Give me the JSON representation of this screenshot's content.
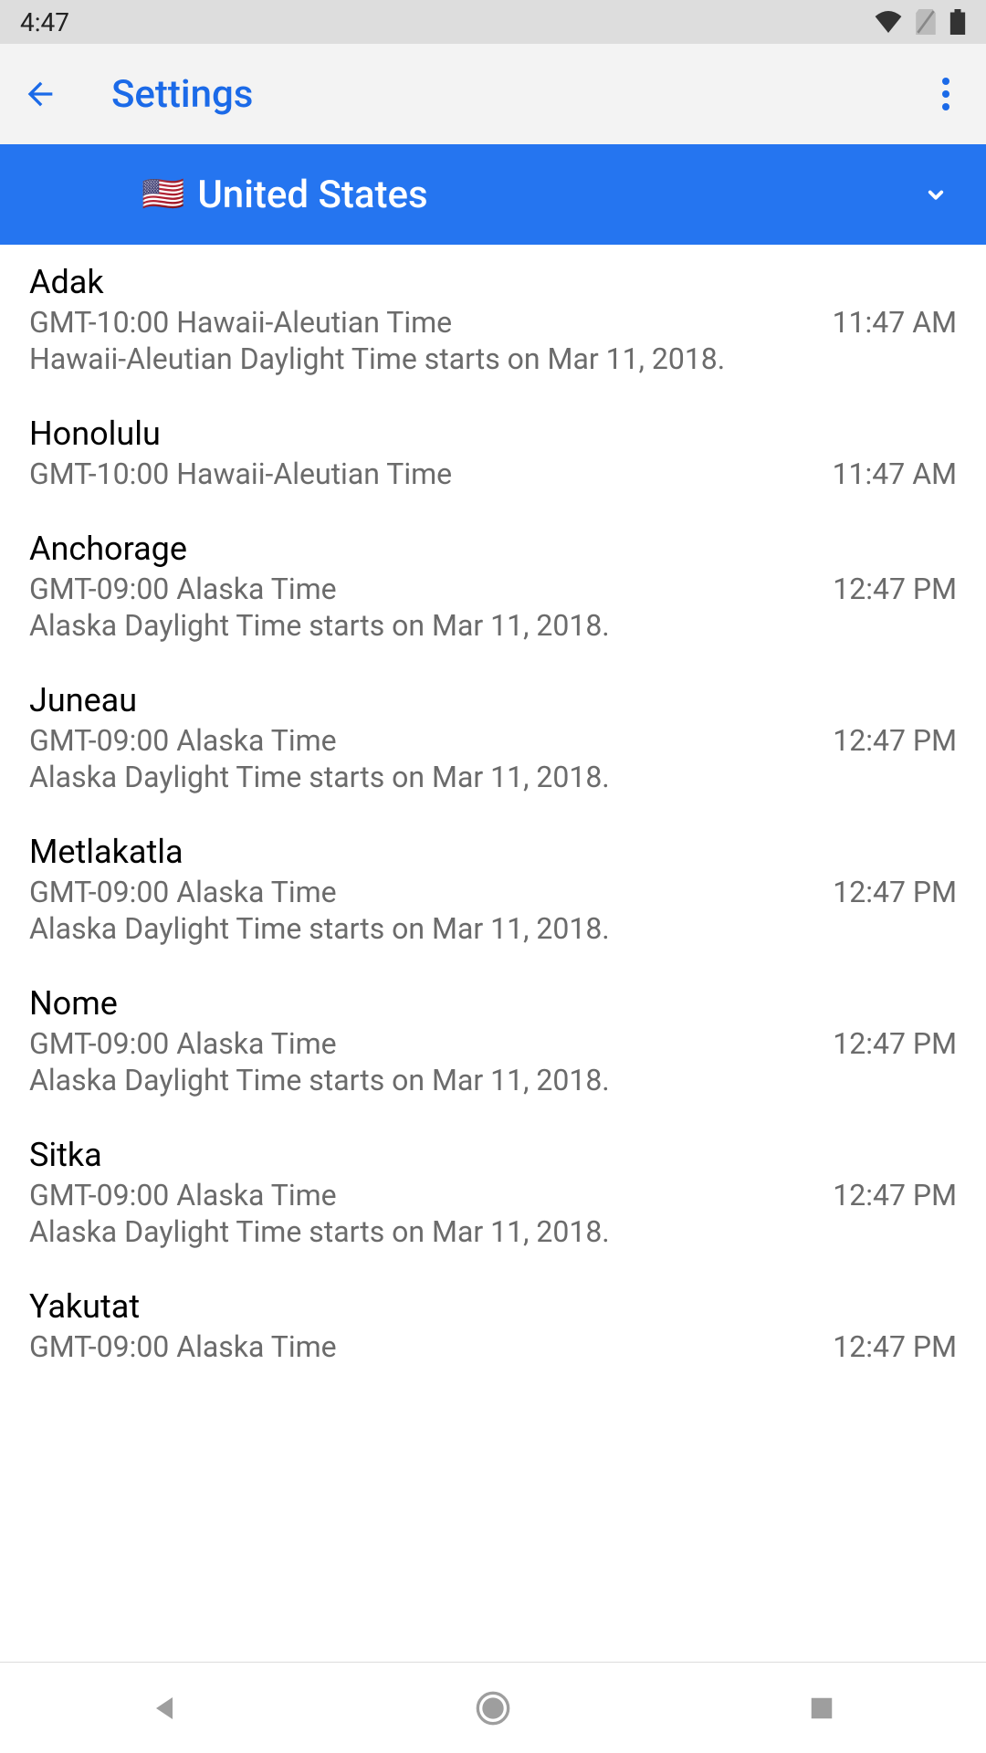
{
  "status": {
    "time": "4:47"
  },
  "app_bar": {
    "title": "Settings"
  },
  "region": {
    "flag": "🇺🇸",
    "name": "United States"
  },
  "timezones": [
    {
      "city": "Adak",
      "offset": "GMT-10:00 Hawaii-Aleutian Time",
      "current": "11:47 AM",
      "dst": "Hawaii-Aleutian Daylight Time starts on Mar 11, 2018."
    },
    {
      "city": "Honolulu",
      "offset": "GMT-10:00 Hawaii-Aleutian Time",
      "current": "11:47 AM",
      "dst": ""
    },
    {
      "city": "Anchorage",
      "offset": "GMT-09:00 Alaska Time",
      "current": "12:47 PM",
      "dst": "Alaska Daylight Time starts on Mar 11, 2018."
    },
    {
      "city": "Juneau",
      "offset": "GMT-09:00 Alaska Time",
      "current": "12:47 PM",
      "dst": "Alaska Daylight Time starts on Mar 11, 2018."
    },
    {
      "city": "Metlakatla",
      "offset": "GMT-09:00 Alaska Time",
      "current": "12:47 PM",
      "dst": "Alaska Daylight Time starts on Mar 11, 2018."
    },
    {
      "city": "Nome",
      "offset": "GMT-09:00 Alaska Time",
      "current": "12:47 PM",
      "dst": "Alaska Daylight Time starts on Mar 11, 2018."
    },
    {
      "city": "Sitka",
      "offset": "GMT-09:00 Alaska Time",
      "current": "12:47 PM",
      "dst": "Alaska Daylight Time starts on Mar 11, 2018."
    },
    {
      "city": "Yakutat",
      "offset": "GMT-09:00 Alaska Time",
      "current": "12:47 PM",
      "dst": ""
    }
  ]
}
